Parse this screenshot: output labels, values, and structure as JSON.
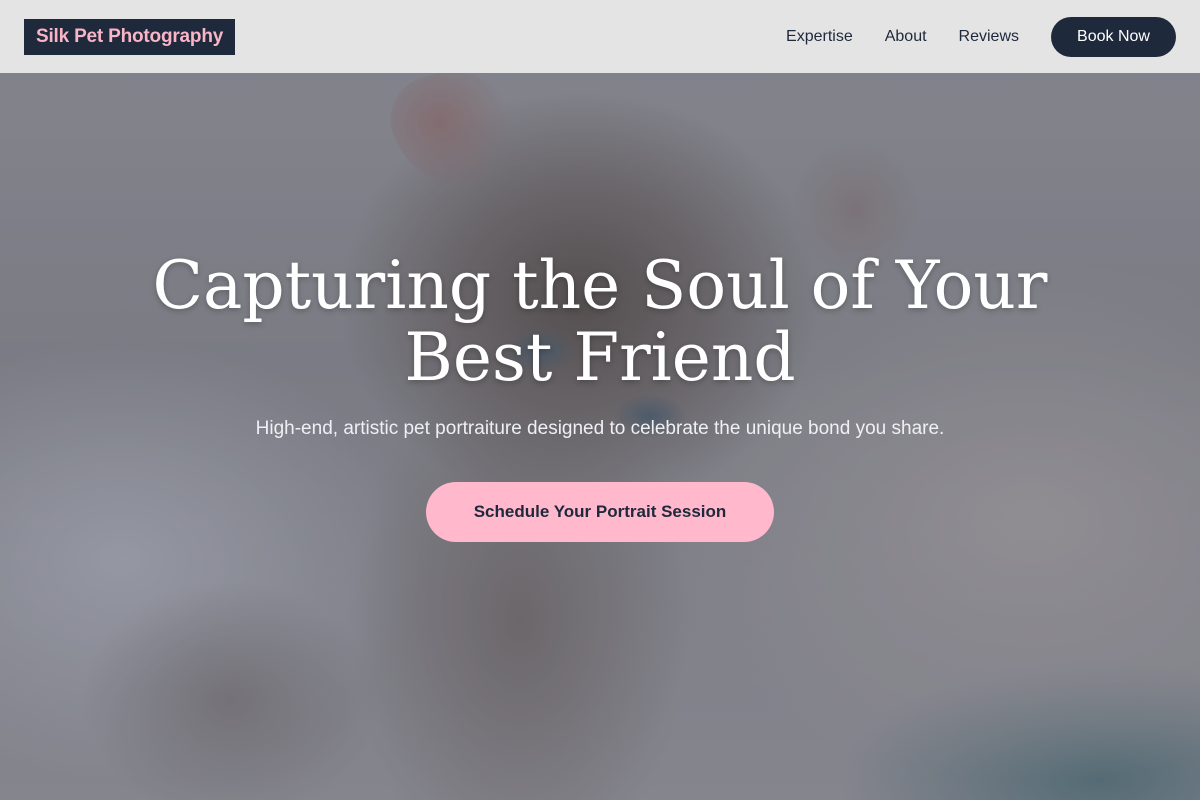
{
  "header": {
    "logo": "Silk Pet Photography",
    "nav": [
      {
        "label": "Expertise"
      },
      {
        "label": "About"
      },
      {
        "label": "Reviews"
      }
    ],
    "cta_label": "Book Now"
  },
  "hero": {
    "title": "Capturing the Soul of Your Best Friend",
    "subtitle": "High-end, artistic pet portraiture designed to celebrate the unique bond you share.",
    "cta_label": "Schedule Your Portrait Session"
  },
  "colors": {
    "brand_dark": "#1e293b",
    "brand_pink": "#ffb8cc",
    "header_bg": "#e8e8e8"
  }
}
